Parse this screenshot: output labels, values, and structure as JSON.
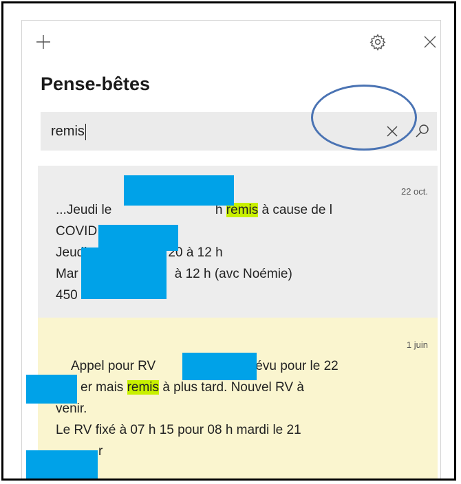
{
  "app": {
    "title": "Pense-bêtes"
  },
  "search": {
    "value": "remis"
  },
  "notes": [
    {
      "date": "22 oct.",
      "lines": [
        {
          "pre": "...Jeudi le",
          "mid": "h",
          "match": "remis",
          "post": "à cause de l"
        },
        "COVID",
        "Jeudi",
        "20 à 12 h",
        "Mar",
        "à 12 h (avc Noémie)",
        "450"
      ]
    },
    {
      "date": "1 juin",
      "lines": [
        {
          "a": "Appel pour RV",
          "b": "r prévu pour le 22"
        },
        {
          "a": "er mais",
          "match": "remis",
          "b": "à plus tard.  Nouvel RV à"
        },
        "venir.",
        "Le RV fixé à 07 h 15 pour 08 h mardi le 21",
        "r"
      ]
    }
  ],
  "icons": {
    "add": "plus-icon",
    "settings": "gear-icon",
    "close": "close-icon",
    "clear": "clear-icon",
    "search": "search-icon"
  },
  "colors": {
    "match_highlight": "#c8f000",
    "redaction": "#00a2e8",
    "annotation_circle": "#4a73b3"
  }
}
